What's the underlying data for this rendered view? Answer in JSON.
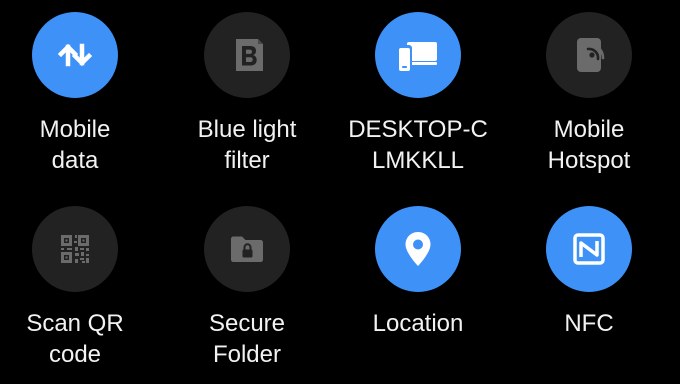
{
  "colors": {
    "background": "#000000",
    "tile_on": "#3e91f7",
    "tile_off": "#222222",
    "icon_on": "#ffffff",
    "icon_off": "#6b6b6b",
    "label": "#f2f2f2"
  },
  "tiles": [
    {
      "id": "mobile-data",
      "icon": "up-down-arrows-icon",
      "state": "on",
      "label_lines": [
        "Mobile",
        "data"
      ]
    },
    {
      "id": "blue-light-filter",
      "icon": "b-letter-icon",
      "state": "off",
      "label_lines": [
        "Blue light",
        "filter"
      ]
    },
    {
      "id": "desktop-connect",
      "icon": "devices-icon",
      "state": "on",
      "label_lines": [
        "DESKTOP-C",
        "LMKKLL"
      ]
    },
    {
      "id": "mobile-hotspot",
      "icon": "hotspot-icon",
      "state": "off",
      "label_lines": [
        "Mobile",
        "Hotspot"
      ]
    },
    {
      "id": "scan-qr-code",
      "icon": "qr-code-icon",
      "state": "off",
      "label_lines": [
        "Scan QR",
        "code"
      ]
    },
    {
      "id": "secure-folder",
      "icon": "folder-lock-icon",
      "state": "off",
      "label_lines": [
        "Secure",
        "Folder"
      ]
    },
    {
      "id": "location",
      "icon": "location-pin-icon",
      "state": "on",
      "label_lines": [
        "Location"
      ]
    },
    {
      "id": "nfc",
      "icon": "nfc-icon",
      "state": "on",
      "label_lines": [
        "NFC"
      ]
    }
  ]
}
